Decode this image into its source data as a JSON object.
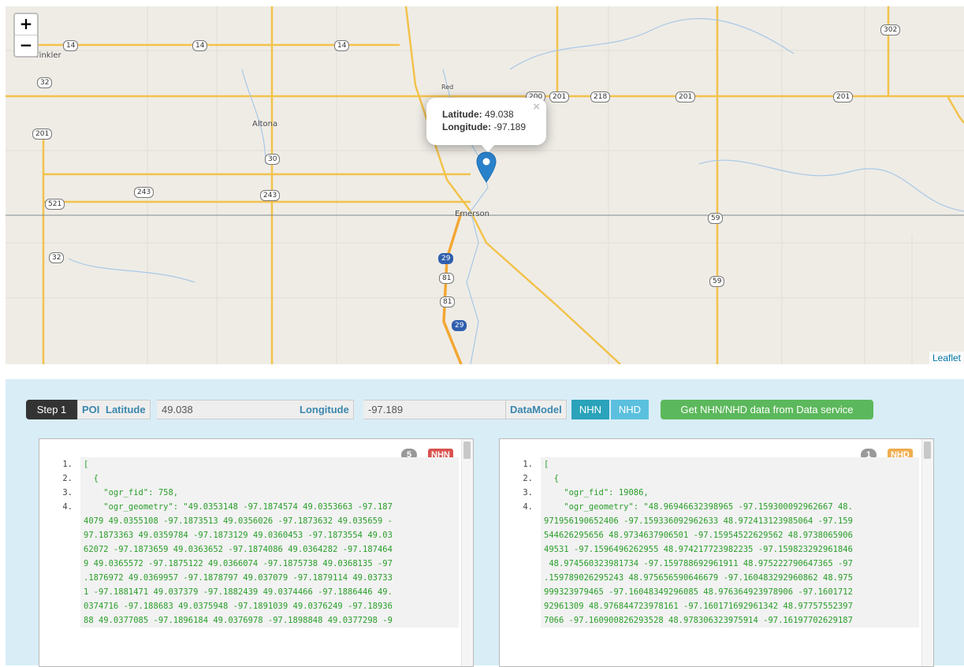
{
  "map": {
    "zoom_in": "+",
    "zoom_out": "−",
    "attribution": "Leaflet",
    "popup": {
      "lat_label": "Latitude:",
      "lat_value": "49.038",
      "lon_label": "Longitude:",
      "lon_value": "-97.189",
      "close": "×"
    },
    "towns": {
      "winkler": "Winkler",
      "altona": "Altona",
      "emerson": "Emerson",
      "red": "Red"
    },
    "shields": {
      "s14a": "14",
      "s14b": "14",
      "s14c": "14",
      "s302": "302",
      "s32a": "32",
      "s201a": "201",
      "s200": "200",
      "s201b": "201",
      "s218": "218",
      "s201c": "201",
      "s201d": "201",
      "s30": "30",
      "s243a": "243",
      "s243b": "243",
      "s521": "521",
      "s59a": "59",
      "s32b": "32",
      "s29a": "29",
      "s81a": "81",
      "s59b": "59",
      "s81b": "81",
      "s29b": "29"
    },
    "marker_icon": "map-marker-icon",
    "marker_color": "#2a81cb"
  },
  "toolbar": {
    "step": "Step 1",
    "poi": "POI",
    "latitude_label": "Latitude",
    "latitude_value": "49.038",
    "longitude_label": "Longitude",
    "longitude_value": "-97.189",
    "datamodel_label": "DataModel",
    "nhn_button": "NHN",
    "nhd_button": "NHD",
    "fetch_button": "Get NHN/NHD data from Data service"
  },
  "left_pane": {
    "count": "5",
    "label": "NHN",
    "label_color": "#d9534f",
    "lines": [
      {
        "n": "1.",
        "t": "["
      },
      {
        "n": "2.",
        "t": "  {"
      },
      {
        "n": "3.",
        "t": "    \"ogr_fid\": 758,"
      },
      {
        "n": "4.",
        "t": "    \"ogr_geometry\": \"49.0353148 -97.1874574 49.0353663 -97.187"
      },
      {
        "n": "",
        "t": "4079 49.0355108 -97.1873513 49.0356026 -97.1873632 49.035659 -"
      },
      {
        "n": "",
        "t": "97.1873363 49.0359784 -97.1873129 49.0360453 -97.1873554 49.03"
      },
      {
        "n": "",
        "t": "62072 -97.1873659 49.0363652 -97.1874086 49.0364282 -97.187464"
      },
      {
        "n": "",
        "t": "9 49.0365572 -97.1875122 49.0366074 -97.1875738 49.0368135 -97"
      },
      {
        "n": "",
        "t": ".1876972 49.0369957 -97.1878797 49.037079 -97.1879114 49.03733"
      },
      {
        "n": "",
        "t": "1 -97.1881471 49.037379 -97.1882439 49.0374466 -97.1886446 49."
      },
      {
        "n": "",
        "t": "0374716 -97.188683 49.0375948 -97.1891039 49.0376249 -97.18936"
      },
      {
        "n": "",
        "t": "88 49.0377085 -97.1896184 49.0376978 -97.1898848 49.0377298 -9"
      }
    ]
  },
  "right_pane": {
    "count": "1",
    "label": "NHD",
    "label_color": "#f0ad4e",
    "lines": [
      {
        "n": "1.",
        "t": "["
      },
      {
        "n": "2.",
        "t": "  {"
      },
      {
        "n": "3.",
        "t": "    \"ogr_fid\": 19086,"
      },
      {
        "n": "4.",
        "t": "    \"ogr_geometry\": \"48.96946632398965 -97.159300092962667 48."
      },
      {
        "n": "",
        "t": "971956190652406 -97.159336092962633 48.972413123985064 -97.159"
      },
      {
        "n": "",
        "t": "544626295656 48.9734637906501 -97.15954522629562 48.9738065906"
      },
      {
        "n": "",
        "t": "49531 -97.1596496262955 48.974217723982235 -97.159823292961846"
      },
      {
        "n": "",
        "t": " 48.974560323981734 -97.159788692961911 48.975222790647365 -97"
      },
      {
        "n": "",
        "t": ".159789026295243 48.975656590646679 -97.160483292960862 48.975"
      },
      {
        "n": "",
        "t": "999323979465 -97.16048349296085 48.976364923978906 -97.1601712"
      },
      {
        "n": "",
        "t": "92961309 48.976844723978161 -97.160171692961342 48.97757552397"
      },
      {
        "n": "",
        "t": "7066 -97.160900826293528 48.978306323975914 -97.16197702629187"
      }
    ]
  }
}
